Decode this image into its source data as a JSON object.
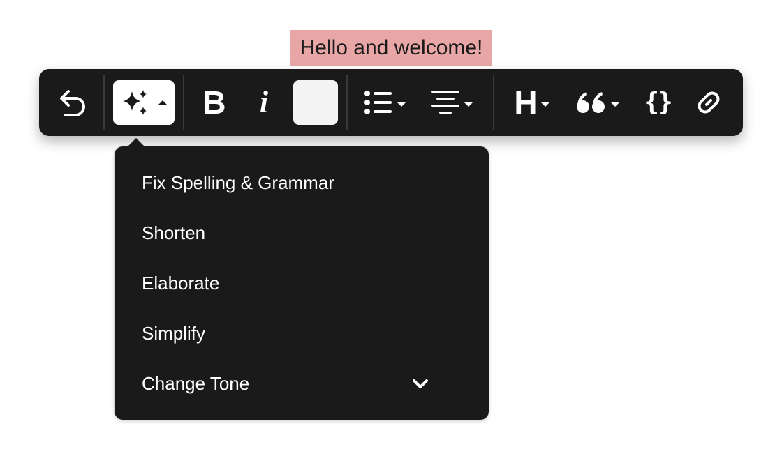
{
  "editor": {
    "selected_text": "Hello and welcome!",
    "highlight_color": "#e8a6a6"
  },
  "toolbar": {
    "background": "#1a1a1a",
    "items": [
      {
        "name": "undo",
        "icon": "undo-icon"
      },
      {
        "name": "ai-assist",
        "icon": "sparkles-icon",
        "expanded": true
      },
      {
        "name": "bold",
        "label": "B"
      },
      {
        "name": "italic",
        "label": "i"
      },
      {
        "name": "text-color",
        "swatch": "#f4f4f4"
      },
      {
        "name": "list",
        "icon": "bulleted-list-icon"
      },
      {
        "name": "align",
        "icon": "align-center-icon"
      },
      {
        "name": "heading",
        "label": "H"
      },
      {
        "name": "quote",
        "icon": "quote-icon"
      },
      {
        "name": "code",
        "label": "{}"
      },
      {
        "name": "link",
        "icon": "link-icon"
      }
    ]
  },
  "ai_menu": {
    "items": [
      {
        "label": "Fix Spelling & Grammar"
      },
      {
        "label": "Shorten"
      },
      {
        "label": "Elaborate"
      },
      {
        "label": "Simplify"
      },
      {
        "label": "Change Tone",
        "submenu": true
      }
    ]
  }
}
